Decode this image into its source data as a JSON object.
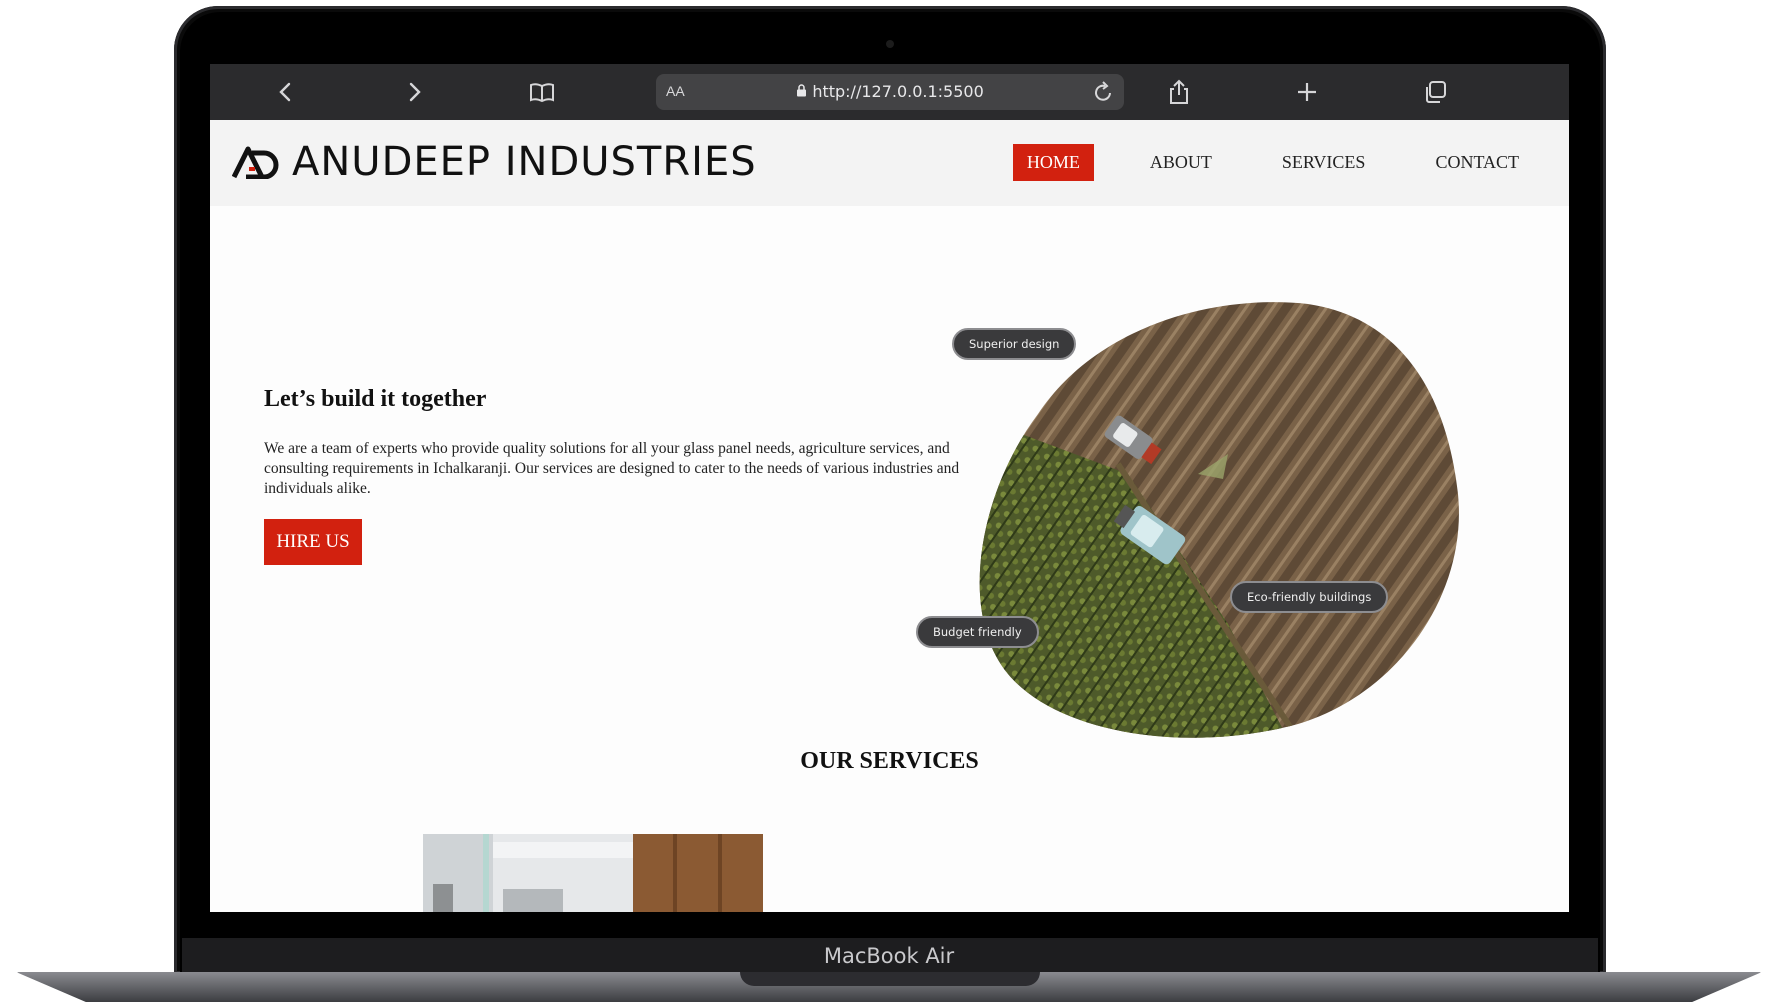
{
  "device": {
    "label": "MacBook Air"
  },
  "browser": {
    "url": "http://127.0.0.1:5500",
    "aa_label": "AA",
    "icons": [
      "back-icon",
      "forward-icon",
      "bookmarks-icon",
      "lock-icon",
      "reload-icon",
      "share-icon",
      "new-tab-icon",
      "tabs-icon"
    ]
  },
  "site": {
    "brand": "ANUDEEP INDUSTRIES",
    "nav": [
      {
        "label": "HOME",
        "active": true
      },
      {
        "label": "ABOUT",
        "active": false
      },
      {
        "label": "SERVICES",
        "active": false
      },
      {
        "label": "CONTACT",
        "active": false
      }
    ],
    "hero": {
      "title": "Let’s build it together",
      "text": "We are a team of experts who provide quality solutions for all your glass panel needs, agriculture services, and consulting requirements in Ichalkaranji. Our services are designed to cater to the needs of various industries and individuals alike.",
      "cta": "HIRE US",
      "tags": [
        "Superior design",
        "Eco-friendly buildings",
        "Budget friendly"
      ]
    },
    "services": {
      "title": "OUR SERVICES"
    }
  },
  "colors": {
    "accent": "#d2210f",
    "toolbar": "#2b2b2d",
    "nav_bg": "#f3f3f3"
  }
}
